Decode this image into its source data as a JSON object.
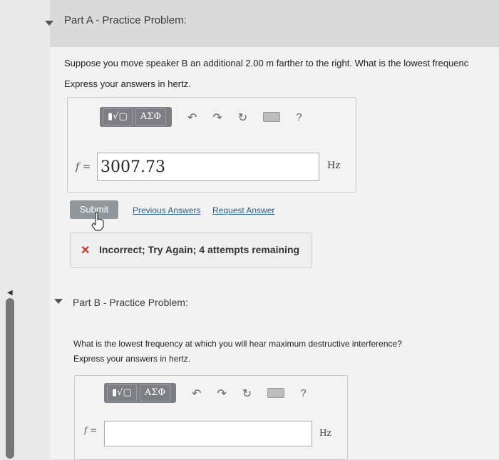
{
  "partA": {
    "title": "Part A - Practice Problem:",
    "question": "Suppose you move speaker B an additional 2.00 m farther to the right. What is the lowest frequenc",
    "instruction": "Express your answers in hertz.",
    "toolbar": {
      "matrix_label": "▮√▢",
      "greek_label": "ΑΣΦ"
    },
    "variable": "f =",
    "answer_value": "3007.73",
    "unit": "Hz",
    "submit_label": "Submit",
    "previous_answers_label": "Previous Answers",
    "request_answer_label": "Request Answer",
    "feedback": "Incorrect; Try Again; 4 attempts remaining"
  },
  "partB": {
    "title": "Part B - Practice Problem:",
    "question": "What is the lowest frequency at which you will hear maximum destructive interference?",
    "instruction": "Express your answers in hertz.",
    "toolbar": {
      "matrix_label": "▮√▢",
      "greek_label": "ΑΣΦ"
    },
    "variable": "f =",
    "answer_value": "",
    "unit": "Hz"
  },
  "colors": {
    "accent": "#2b5f8f",
    "error": "#c0392b",
    "submit": "#8f979d"
  }
}
